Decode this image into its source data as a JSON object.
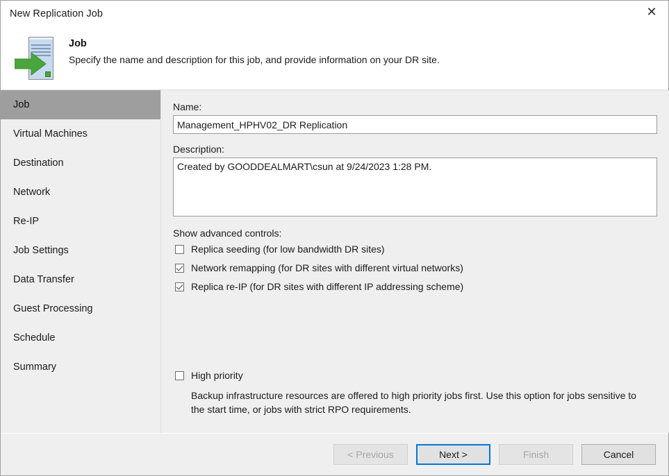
{
  "window": {
    "title": "New Replication Job",
    "close_icon": "close-icon"
  },
  "header": {
    "icon": "replication-job-icon",
    "title": "Job",
    "subtitle": "Specify the name and description for this job, and provide information on your DR site."
  },
  "sidebar": {
    "items": [
      {
        "label": "Job",
        "selected": true
      },
      {
        "label": "Virtual Machines",
        "selected": false
      },
      {
        "label": "Destination",
        "selected": false
      },
      {
        "label": "Network",
        "selected": false
      },
      {
        "label": "Re-IP",
        "selected": false
      },
      {
        "label": "Job Settings",
        "selected": false
      },
      {
        "label": "Data Transfer",
        "selected": false
      },
      {
        "label": "Guest Processing",
        "selected": false
      },
      {
        "label": "Schedule",
        "selected": false
      },
      {
        "label": "Summary",
        "selected": false
      }
    ]
  },
  "form": {
    "name_label": "Name:",
    "name_value": "Management_HPHV02_DR Replication",
    "description_label": "Description:",
    "description_value": "Created by GOODDEALMART\\csun at 9/24/2023 1:28 PM.",
    "advanced_label": "Show advanced controls:",
    "checkboxes": [
      {
        "label": "Replica seeding (for low bandwidth DR sites)",
        "checked": false
      },
      {
        "label": "Network remapping (for DR sites with different virtual networks)",
        "checked": true
      },
      {
        "label": "Replica re-IP (for DR sites with different IP addressing scheme)",
        "checked": true
      }
    ],
    "high_priority": {
      "label": "High priority",
      "checked": false,
      "description": "Backup infrastructure resources are offered to high priority jobs first. Use this option for jobs sensitive to the start time, or jobs with strict RPO requirements."
    }
  },
  "footer": {
    "previous": "< Previous",
    "next": "Next >",
    "finish": "Finish",
    "cancel": "Cancel"
  },
  "colors": {
    "focus_blue": "#0078d7",
    "panel_gray": "#efeff0",
    "selection_gray": "#9e9e9e",
    "accent_green": "#4aa63c"
  }
}
